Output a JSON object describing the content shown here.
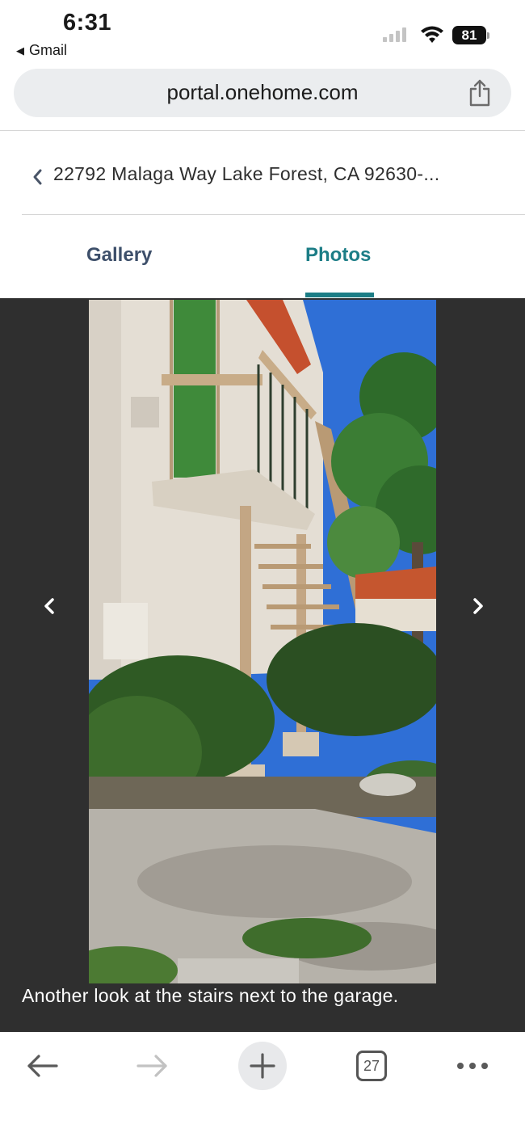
{
  "status_bar": {
    "time": "6:31",
    "back_app": "Gmail",
    "battery_level": "81"
  },
  "browser": {
    "url": "portal.onehome.com",
    "tab_count": "27"
  },
  "listing": {
    "address": "22792 Malaga Way Lake Forest, CA 92630-..."
  },
  "tabs": [
    {
      "label": "Gallery",
      "active": false
    },
    {
      "label": "Photos",
      "active": true
    }
  ],
  "photo": {
    "caption": "Another look at the stairs next to the garage."
  },
  "icons": {
    "signal": "cellular-signal-icon",
    "wifi": "wifi-icon",
    "share": "share-icon",
    "back_chevron": "chevron-left-icon",
    "prev": "chevron-left-icon",
    "next": "chevron-right-icon",
    "nav_back": "arrow-left-icon",
    "nav_forward": "arrow-right-icon",
    "new_tab": "plus-icon",
    "more": "ellipsis-icon"
  },
  "colors": {
    "accent": "#1c7d86",
    "tab_inactive": "#3d4f6a",
    "viewer_bg": "#2f2f2f",
    "url_bar_bg": "#ebedef"
  }
}
